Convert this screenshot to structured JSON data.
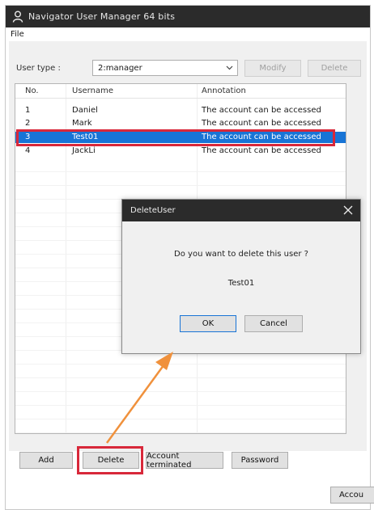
{
  "window": {
    "title": "Navigator User Manager 64 bits",
    "menu": {
      "file": "File"
    }
  },
  "controls": {
    "user_type_label": "User type :",
    "user_type_value": "2:manager",
    "modify_label": "Modify",
    "delete_top_label": "Delete"
  },
  "table": {
    "headers": [
      "No.",
      "Username",
      "Annotation"
    ],
    "rows": [
      {
        "no": "1",
        "username": "Daniel",
        "annotation": "The account can be accessed"
      },
      {
        "no": "2",
        "username": "Mark",
        "annotation": "The account can be accessed"
      },
      {
        "no": "3",
        "username": "Test01",
        "annotation": "The account can be accessed"
      },
      {
        "no": "4",
        "username": "JackLi",
        "annotation": "The account can be accessed"
      }
    ],
    "selected_row": 2
  },
  "dialog": {
    "title": "DeleteUser",
    "message": "Do you want to delete this user ?",
    "target": "Test01",
    "ok_label": "OK",
    "cancel_label": "Cancel"
  },
  "bottom": {
    "add_label": "Add",
    "delete_label": "Delete",
    "terminated_label": "Account terminated",
    "password_label": "Password",
    "account_label": "Accou"
  },
  "colors": {
    "highlight": "#d8283a",
    "arrow": "#f0913c",
    "selection": "#1874d6",
    "titlebar": "#2b2b2b"
  }
}
